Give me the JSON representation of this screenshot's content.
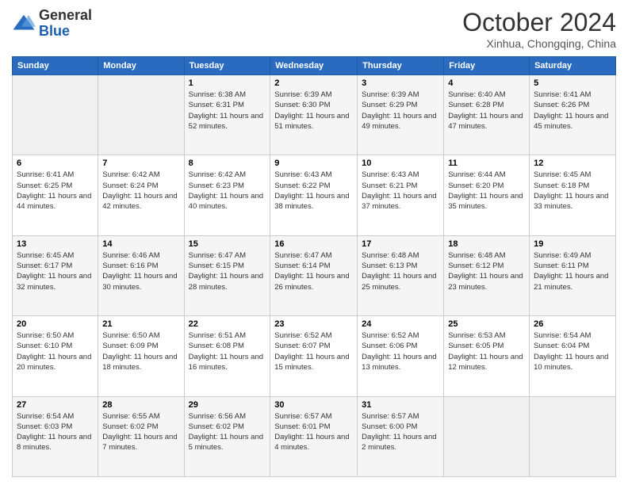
{
  "logo": {
    "general": "General",
    "blue": "Blue"
  },
  "title": "October 2024",
  "location": "Xinhua, Chongqing, China",
  "days_header": [
    "Sunday",
    "Monday",
    "Tuesday",
    "Wednesday",
    "Thursday",
    "Friday",
    "Saturday"
  ],
  "weeks": [
    [
      {
        "day": "",
        "info": ""
      },
      {
        "day": "",
        "info": ""
      },
      {
        "day": "1",
        "info": "Sunrise: 6:38 AM\nSunset: 6:31 PM\nDaylight: 11 hours and 52 minutes."
      },
      {
        "day": "2",
        "info": "Sunrise: 6:39 AM\nSunset: 6:30 PM\nDaylight: 11 hours and 51 minutes."
      },
      {
        "day": "3",
        "info": "Sunrise: 6:39 AM\nSunset: 6:29 PM\nDaylight: 11 hours and 49 minutes."
      },
      {
        "day": "4",
        "info": "Sunrise: 6:40 AM\nSunset: 6:28 PM\nDaylight: 11 hours and 47 minutes."
      },
      {
        "day": "5",
        "info": "Sunrise: 6:41 AM\nSunset: 6:26 PM\nDaylight: 11 hours and 45 minutes."
      }
    ],
    [
      {
        "day": "6",
        "info": "Sunrise: 6:41 AM\nSunset: 6:25 PM\nDaylight: 11 hours and 44 minutes."
      },
      {
        "day": "7",
        "info": "Sunrise: 6:42 AM\nSunset: 6:24 PM\nDaylight: 11 hours and 42 minutes."
      },
      {
        "day": "8",
        "info": "Sunrise: 6:42 AM\nSunset: 6:23 PM\nDaylight: 11 hours and 40 minutes."
      },
      {
        "day": "9",
        "info": "Sunrise: 6:43 AM\nSunset: 6:22 PM\nDaylight: 11 hours and 38 minutes."
      },
      {
        "day": "10",
        "info": "Sunrise: 6:43 AM\nSunset: 6:21 PM\nDaylight: 11 hours and 37 minutes."
      },
      {
        "day": "11",
        "info": "Sunrise: 6:44 AM\nSunset: 6:20 PM\nDaylight: 11 hours and 35 minutes."
      },
      {
        "day": "12",
        "info": "Sunrise: 6:45 AM\nSunset: 6:18 PM\nDaylight: 11 hours and 33 minutes."
      }
    ],
    [
      {
        "day": "13",
        "info": "Sunrise: 6:45 AM\nSunset: 6:17 PM\nDaylight: 11 hours and 32 minutes."
      },
      {
        "day": "14",
        "info": "Sunrise: 6:46 AM\nSunset: 6:16 PM\nDaylight: 11 hours and 30 minutes."
      },
      {
        "day": "15",
        "info": "Sunrise: 6:47 AM\nSunset: 6:15 PM\nDaylight: 11 hours and 28 minutes."
      },
      {
        "day": "16",
        "info": "Sunrise: 6:47 AM\nSunset: 6:14 PM\nDaylight: 11 hours and 26 minutes."
      },
      {
        "day": "17",
        "info": "Sunrise: 6:48 AM\nSunset: 6:13 PM\nDaylight: 11 hours and 25 minutes."
      },
      {
        "day": "18",
        "info": "Sunrise: 6:48 AM\nSunset: 6:12 PM\nDaylight: 11 hours and 23 minutes."
      },
      {
        "day": "19",
        "info": "Sunrise: 6:49 AM\nSunset: 6:11 PM\nDaylight: 11 hours and 21 minutes."
      }
    ],
    [
      {
        "day": "20",
        "info": "Sunrise: 6:50 AM\nSunset: 6:10 PM\nDaylight: 11 hours and 20 minutes."
      },
      {
        "day": "21",
        "info": "Sunrise: 6:50 AM\nSunset: 6:09 PM\nDaylight: 11 hours and 18 minutes."
      },
      {
        "day": "22",
        "info": "Sunrise: 6:51 AM\nSunset: 6:08 PM\nDaylight: 11 hours and 16 minutes."
      },
      {
        "day": "23",
        "info": "Sunrise: 6:52 AM\nSunset: 6:07 PM\nDaylight: 11 hours and 15 minutes."
      },
      {
        "day": "24",
        "info": "Sunrise: 6:52 AM\nSunset: 6:06 PM\nDaylight: 11 hours and 13 minutes."
      },
      {
        "day": "25",
        "info": "Sunrise: 6:53 AM\nSunset: 6:05 PM\nDaylight: 11 hours and 12 minutes."
      },
      {
        "day": "26",
        "info": "Sunrise: 6:54 AM\nSunset: 6:04 PM\nDaylight: 11 hours and 10 minutes."
      }
    ],
    [
      {
        "day": "27",
        "info": "Sunrise: 6:54 AM\nSunset: 6:03 PM\nDaylight: 11 hours and 8 minutes."
      },
      {
        "day": "28",
        "info": "Sunrise: 6:55 AM\nSunset: 6:02 PM\nDaylight: 11 hours and 7 minutes."
      },
      {
        "day": "29",
        "info": "Sunrise: 6:56 AM\nSunset: 6:02 PM\nDaylight: 11 hours and 5 minutes."
      },
      {
        "day": "30",
        "info": "Sunrise: 6:57 AM\nSunset: 6:01 PM\nDaylight: 11 hours and 4 minutes."
      },
      {
        "day": "31",
        "info": "Sunrise: 6:57 AM\nSunset: 6:00 PM\nDaylight: 11 hours and 2 minutes."
      },
      {
        "day": "",
        "info": ""
      },
      {
        "day": "",
        "info": ""
      }
    ]
  ]
}
